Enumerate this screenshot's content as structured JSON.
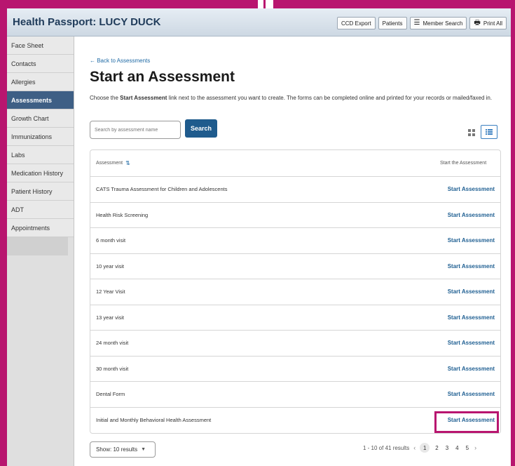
{
  "header": {
    "title": "Health Passport: LUCY DUCK",
    "buttons": [
      {
        "label": "CCD Export",
        "icon": ""
      },
      {
        "label": "Patients",
        "icon": ""
      },
      {
        "label": "Member Search",
        "icon": "menu-icon"
      },
      {
        "label": "Print All",
        "icon": "printer-icon"
      }
    ]
  },
  "sidebar": {
    "items": [
      {
        "label": "Face Sheet",
        "active": false
      },
      {
        "label": "Contacts",
        "active": false
      },
      {
        "label": "Allergies",
        "active": false
      },
      {
        "label": "Assessments",
        "active": true
      },
      {
        "label": "Growth Chart",
        "active": false
      },
      {
        "label": "Immunizations",
        "active": false
      },
      {
        "label": "Labs",
        "active": false
      },
      {
        "label": "Medication History",
        "active": false
      },
      {
        "label": "Patient History",
        "active": false
      },
      {
        "label": "ADT",
        "active": false
      },
      {
        "label": "Appointments",
        "active": false
      }
    ]
  },
  "main": {
    "back_link": "← Back to Assessments",
    "title": "Start an Assessment",
    "description_prefix": "Choose the ",
    "description_bold": "Start Assessment",
    "description_suffix": " link next to the assessment you want to create. The forms can be completed online and printed for your records or mailed/faxed in.",
    "search": {
      "placeholder": "Search by assessment name",
      "button_label": "Search"
    },
    "table": {
      "col_assessment": "Assessment",
      "col_start": "Start the Assessment",
      "rows": [
        {
          "name": "CATS Trauma Assessment for Children and Adolescents",
          "action": "Start Assessment"
        },
        {
          "name": "Health Risk Screening",
          "action": "Start Assessment"
        },
        {
          "name": "6 month visit",
          "action": "Start Assessment"
        },
        {
          "name": "10 year visit",
          "action": "Start Assessment"
        },
        {
          "name": "12 Year Visit",
          "action": "Start Assessment"
        },
        {
          "name": "13 year visit",
          "action": "Start Assessment"
        },
        {
          "name": "24 month visit",
          "action": "Start Assessment"
        },
        {
          "name": "30 month visit",
          "action": "Start Assessment"
        },
        {
          "name": "Dental Form",
          "action": "Start Assessment"
        },
        {
          "name": "Initial and Monthly Behavioral Health Assessment",
          "action": "Start Assessment"
        }
      ]
    },
    "footer": {
      "show_label": "Show: 10 results",
      "results_text": "1 - 10 of 41 results",
      "pages": [
        "1",
        "2",
        "3",
        "4",
        "5"
      ],
      "active_page": "1"
    }
  },
  "colors": {
    "highlight": "#b8156f",
    "active_sidebar": "#3e5f85",
    "search_button": "#1f5b8d",
    "link": "#1f5f92"
  }
}
